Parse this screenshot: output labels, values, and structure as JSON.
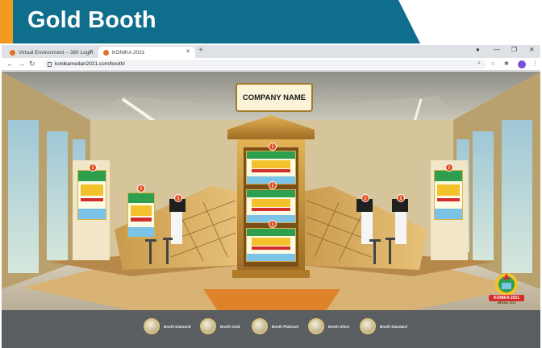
{
  "slide": {
    "title": "Gold Booth"
  },
  "browser": {
    "tabs": [
      {
        "label": "Virtual Environment – 360 Login",
        "active": false
      },
      {
        "label": "KONIKA 2021",
        "active": true
      }
    ],
    "url": "konikamedan2021.com/booth/"
  },
  "booth": {
    "sign": "COMPANY NAME",
    "info_marker": "i"
  },
  "bottom_nav": {
    "items": [
      "Booth Diamond",
      "Booth Gold",
      "Booth Platinum",
      "Booth Silver",
      "Booth Standard"
    ]
  },
  "badge": {
    "label": "KONIKA 2021",
    "sub": "MEDAN, 2021"
  },
  "colors": {
    "title_teal": "#0f6e8b",
    "title_orange": "#f29a1f",
    "gold": "#c8963a"
  }
}
